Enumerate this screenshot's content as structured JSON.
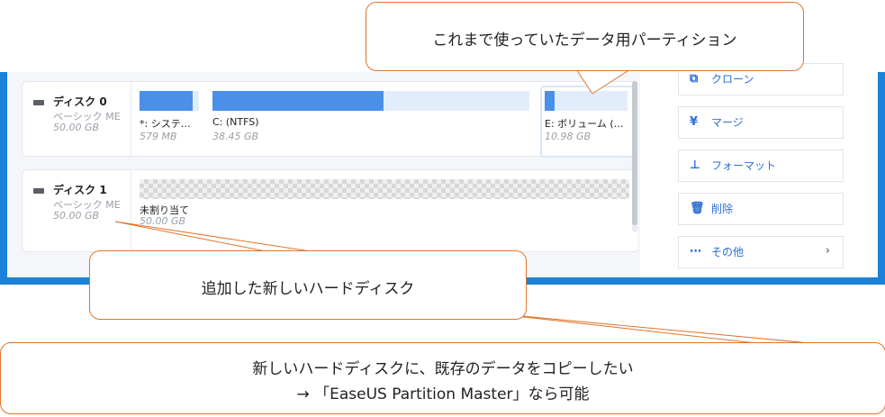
{
  "disks": [
    {
      "name": "ディスク 0",
      "type": "ベーシック ME",
      "size": "50.00 GB",
      "partitions": [
        {
          "label": "*: システ…",
          "size": "579 MB",
          "used_fraction": 0.9
        },
        {
          "label": "C: (NTFS)",
          "size": "38.45 GB",
          "used_fraction": 0.54
        },
        {
          "label": "E: ボリューム (…",
          "size": "10.98 GB",
          "used_fraction": 0.12
        }
      ]
    },
    {
      "name": "ディスク 1",
      "type": "ベーシック ME",
      "size": "50.00 GB",
      "unallocated": {
        "label": "未割り当て",
        "size": "50.00 GB"
      }
    }
  ],
  "actions": [
    {
      "icon": "clone-icon",
      "label": "クローン"
    },
    {
      "icon": "merge-icon",
      "label": "マージ"
    },
    {
      "icon": "format-icon",
      "label": "フォーマット"
    },
    {
      "icon": "delete-icon",
      "label": "削除"
    },
    {
      "icon": "more-icon",
      "label": "その他"
    }
  ],
  "callouts": {
    "top": "これまで使っていたデータ用パーティション",
    "middle": "追加した新しいハードディスク",
    "bottom_line1": "新しいハードディスクに、既存のデータをコピーしたい",
    "bottom_line2": "→ 「EaseUS Partition Master」なら可能"
  },
  "colors": {
    "accent": "#2d6fd6",
    "window_border": "#1a82d8",
    "partition_fill": "#4a90e8",
    "callout_border": "#e0742a"
  }
}
